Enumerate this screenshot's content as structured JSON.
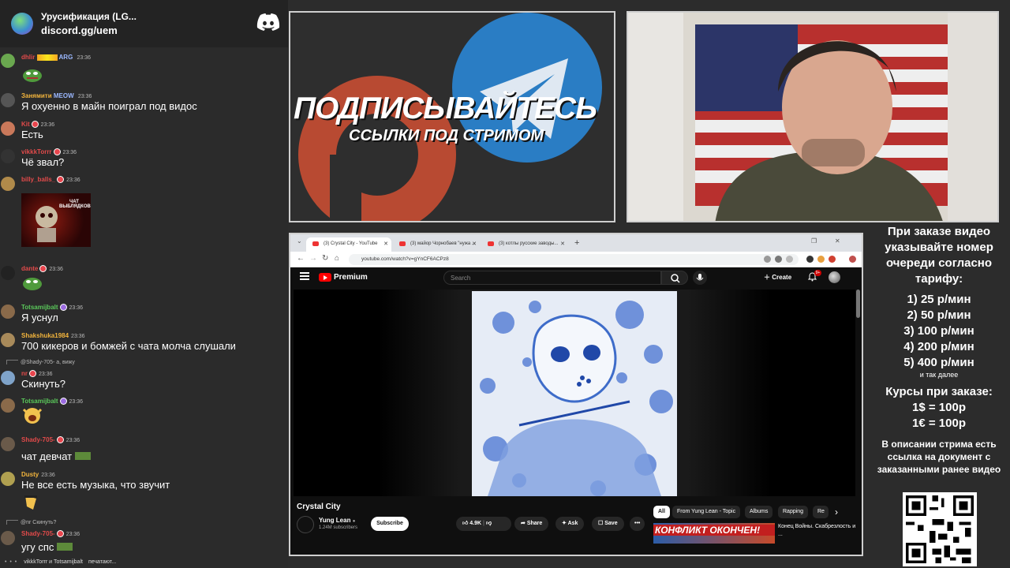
{
  "chat": {
    "server_name": "Урусификация (LG...",
    "server_link": "discord.gg/uem",
    "typing": "vikkkTorrr и Totsamijbalt печатают...",
    "messages": [
      {
        "user": "dhlir",
        "time": "23:36",
        "tag": "ARG",
        "text": "",
        "user_color": "#e14a4a"
      },
      {
        "user": "Занямити",
        "tag": "MEOW",
        "time": "23:36",
        "text": "Я охуенно в майн поиграл под видос",
        "user_color": "#f2b43c"
      },
      {
        "user": "Kit",
        "time": "23:36",
        "text": "Есть",
        "user_color": "#e14a4a"
      },
      {
        "user": "vikkkTorrr",
        "time": "23:36",
        "text": "Чё звал?",
        "user_color": "#e14a4a"
      },
      {
        "user": "billy_balls_",
        "time": "23:36",
        "text": "",
        "user_color": "#e14a4a",
        "image_caption": "ЧАТ ВЫБЛЯДКОВ"
      },
      {
        "user": "dante",
        "time": "23:36",
        "text": "",
        "user_color": "#e14a4a"
      },
      {
        "user": "Totsamijbalt",
        "time": "23:36",
        "text": "Я уснул",
        "user_color": "#5ac85a"
      },
      {
        "user": "Shakshuka1984",
        "time": "23:36",
        "text": "700 кикеров и бомжей с чата молча слушали",
        "user_color": "#f2b43c"
      },
      {
        "user": "nr",
        "time": "23:36",
        "reply": "@Shady-705- а, вижу",
        "text": "Скинуть?",
        "user_color": "#e14a4a"
      },
      {
        "user": "Totsamijbalt",
        "time": "23:36",
        "text": "",
        "user_color": "#5ac85a"
      },
      {
        "user": "Shady-705-",
        "time": "23:36",
        "text": "чат девчат",
        "user_color": "#e14a4a"
      },
      {
        "user": "Dusty",
        "time": "23:36",
        "text": "Не все есть музыка, что звучит",
        "user_color": "#f2b43c"
      },
      {
        "user": "Shady-705-",
        "time": "23:36",
        "reply": "@nr Скинуть?",
        "text": "угу спс",
        "user_color": "#e14a4a"
      }
    ]
  },
  "promo": {
    "headline": "ПОДПИСЫВАЙТЕСЬ",
    "sub": "ССЫЛКИ ПОД СТРИМОМ"
  },
  "browser": {
    "tabs": [
      {
        "title": "(3) Crystal City - YouTube"
      },
      {
        "title": "(3) майор Чорнобаев \"нужа ..."
      },
      {
        "title": "(3) котлы русские заводы..."
      }
    ],
    "url": "youtube.com/watch?v=gYnCF6ACPz8"
  },
  "youtube": {
    "brand": "Premium",
    "search_placeholder": "Search",
    "create": "Create",
    "notifications": "9+",
    "video_title": "Crystal City",
    "channel": "Yung Lean",
    "subscribers": "1.24M subscribers",
    "subscribe": "Subscribe",
    "likes": "4.9K",
    "share": "Share",
    "ask": "Ask",
    "save": "Save",
    "more": "•••",
    "chips": [
      "All",
      "From Yung Lean - Topic",
      "Albums",
      "Rapping",
      "Re"
    ],
    "rec_thumb_text": "КОНФЛИКТ ОКОНЧЕН!",
    "rec_title": "Конец Войны. Скабрезлость и ..."
  },
  "info": {
    "order_text": "При заказе видео указывайте номер очереди согласно тарифу:",
    "tariffs": [
      "1) 25 р/мин",
      "2) 50 р/мин",
      "3) 100 р/мин",
      "4) 200 р/мин",
      "5) 400 р/мин"
    ],
    "etc": "и так далее",
    "rates_title": "Курсы при заказе:",
    "rates": [
      "1$ = 100р",
      "1€ = 100р"
    ],
    "description": "В описании стрима есть ссылка на документ с заказанными ранее видео"
  },
  "colors": {
    "accent_red": "#ff0000",
    "discord": "#ffffff",
    "panel_border": "#cfcfcf"
  }
}
